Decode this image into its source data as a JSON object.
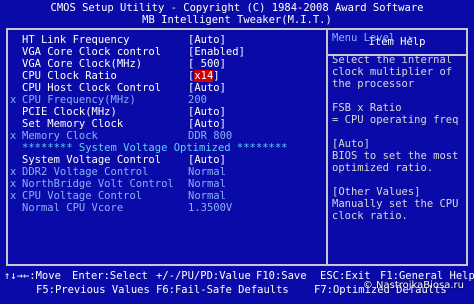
{
  "header": {
    "line1": "CMOS Setup Utility - Copyright (C) 1984-2008 Award Software",
    "line2": "MB Intelligent Tweaker(M.I.T.)"
  },
  "help": {
    "title": "Item Help",
    "menu_level": "Menu Level  ▸",
    "lines": [
      "Select the internal",
      "clock multiplier of",
      "the processor",
      "",
      "FSB x Ratio",
      "= CPU operating freq",
      "",
      "[Auto]",
      "BIOS to set the most",
      "optimized ratio.",
      "",
      "[Other Values]",
      "Manually set the CPU",
      "clock ratio."
    ]
  },
  "settings": [
    {
      "mark": "",
      "label": "HT Link Frequency",
      "value": "[Auto]",
      "state": "normal"
    },
    {
      "mark": "",
      "label": "VGA Core Clock control",
      "value": "[Enabled]",
      "state": "normal"
    },
    {
      "mark": "",
      "label": "VGA Core Clock(MHz)",
      "value": "[ 500]",
      "state": "normal"
    },
    {
      "mark": "",
      "label": "CPU Clock Ratio",
      "value": "x14",
      "state": "selected"
    },
    {
      "mark": "",
      "label": "CPU Host Clock Control",
      "value": "[Auto]",
      "state": "normal"
    },
    {
      "mark": "x",
      "label": "CPU Frequency(MHz)",
      "value": "200",
      "state": "dim"
    },
    {
      "mark": "",
      "label": "PCIE Clock(MHz)",
      "value": "[Auto]",
      "state": "normal"
    },
    {
      "mark": "",
      "label": "Set Memory Clock",
      "value": "[Auto]",
      "state": "normal"
    },
    {
      "mark": "x",
      "label": "Memory Clock",
      "value": "DDR 800",
      "state": "dim"
    },
    {
      "mark": "",
      "label": "******** System Voltage Optimized ********",
      "value": "",
      "state": "section"
    },
    {
      "mark": "",
      "label": "System Voltage Control",
      "value": "[Auto]",
      "state": "normal"
    },
    {
      "mark": "x",
      "label": "DDR2 Voltage Control",
      "value": "Normal",
      "state": "dim"
    },
    {
      "mark": "x",
      "label": "NorthBridge Volt Control",
      "value": "Normal",
      "state": "dim"
    },
    {
      "mark": "x",
      "label": "CPU Voltage Control",
      "value": "Normal",
      "state": "dim"
    },
    {
      "mark": "",
      "label": "Normal CPU Vcore",
      "value": "1.3500V",
      "state": "dim"
    }
  ],
  "footer": {
    "row1": [
      "↑↓→←:Move",
      "Enter:Select",
      "+/-/PU/PD:Value",
      "F10:Save",
      "ESC:Exit",
      "F1:General Help"
    ],
    "row2": [
      "F5:Previous Values",
      "F6:Fail-Safe Defaults",
      "F7:Optimized Defaults"
    ]
  },
  "watermark": "© NastrojkaBiosa.ru",
  "colors": {
    "background": "#0a0aa8",
    "selected": "#d00000",
    "text": "#d8d8d8",
    "dim": "#8ab0ff"
  }
}
